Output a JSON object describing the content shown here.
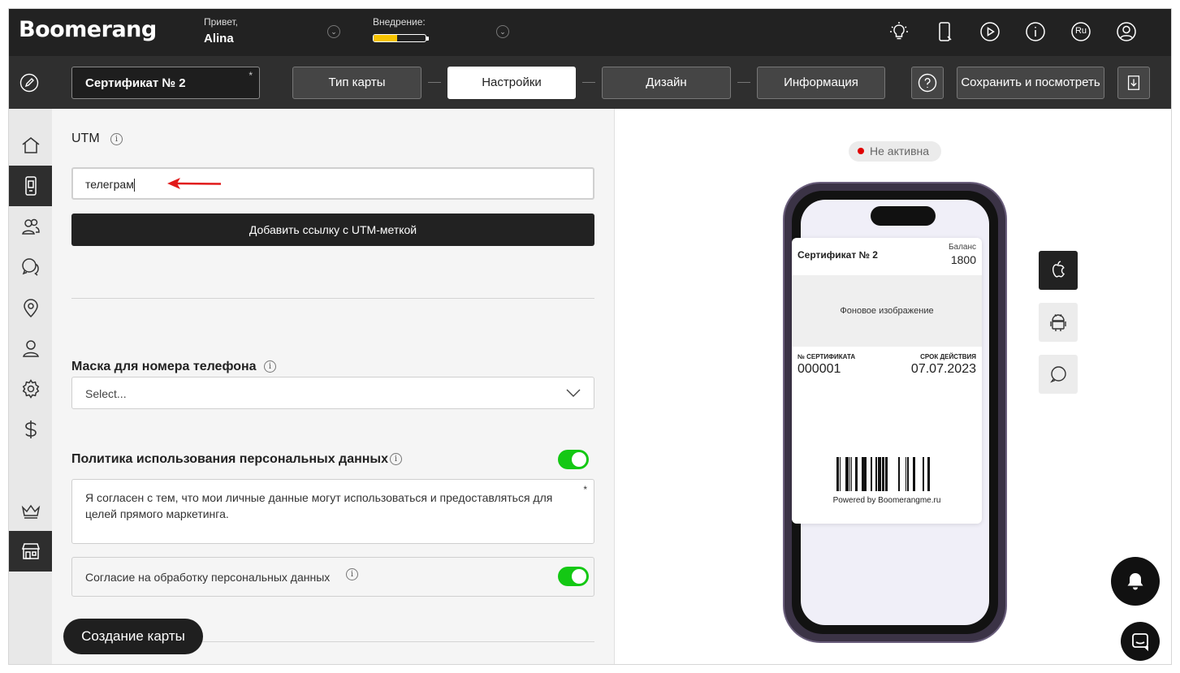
{
  "app": {
    "logo_text": "Boomerang",
    "greeting": "Привет,",
    "user_name": "Alina",
    "implementation_label": "Внедрение:",
    "implementation_progress": 0.45,
    "language": "Ru"
  },
  "colors": {
    "topbar": "#222222",
    "progress_fill": "#f6c300",
    "toggle_on": "#14c814",
    "status_dot": "#e00000"
  },
  "toolbar": {
    "card_name": "Сертификат № 2",
    "required_mark": "*",
    "steps": [
      {
        "label": "Тип карты",
        "active": false
      },
      {
        "label": "Настройки",
        "active": true
      },
      {
        "label": "Дизайн",
        "active": false
      },
      {
        "label": "Информация",
        "active": false
      }
    ],
    "help_icon": "question-icon",
    "save_label": "Сохранить и посмотреть",
    "download_icon": "download-icon"
  },
  "sidebar": {
    "items": [
      {
        "icon": "home-icon",
        "active": false
      },
      {
        "icon": "phone-card-icon",
        "active": true
      },
      {
        "icon": "users-icon",
        "active": false
      },
      {
        "icon": "chat-icon",
        "active": false
      },
      {
        "icon": "location-icon",
        "active": false
      },
      {
        "icon": "user-icon",
        "active": false
      },
      {
        "icon": "gear-icon",
        "active": false
      },
      {
        "icon": "dollar-icon",
        "active": false
      },
      {
        "icon": "crown-icon",
        "active": false
      },
      {
        "icon": "store-icon",
        "active": true
      }
    ]
  },
  "form": {
    "utm_label": "UTM",
    "utm_value": "телеграм",
    "add_utm_button": "Добавить ссылку с UTM-меткой",
    "phone_mask_label": "Маска для номера телефона",
    "phone_mask_value": "Select...",
    "privacy_label": "Политика использования персональных данных",
    "privacy_enabled": true,
    "privacy_text": "Я согласен с тем, что мои личные данные могут использоваться и предоставляться для целей прямого маркетинга.",
    "privacy_required": "*",
    "consent_label": "Согласие на обработку персональных данных",
    "consent_enabled": true,
    "create_card_button": "Создание карты"
  },
  "preview": {
    "status": "Не активна",
    "card": {
      "title": "Сертификат № 2",
      "balance_label": "Баланс",
      "balance_value": "1800",
      "background_text": "Фоновое изображение",
      "number_label": "№ СЕРТИФИКАТА",
      "number_value": "000001",
      "expiry_label": "СРОК ДЕЙСТВИЯ",
      "expiry_value": "07.07.2023",
      "powered_by": "Powered by Boomerangme.ru"
    },
    "platforms": [
      "apple-icon",
      "android-icon",
      "message-icon"
    ]
  }
}
